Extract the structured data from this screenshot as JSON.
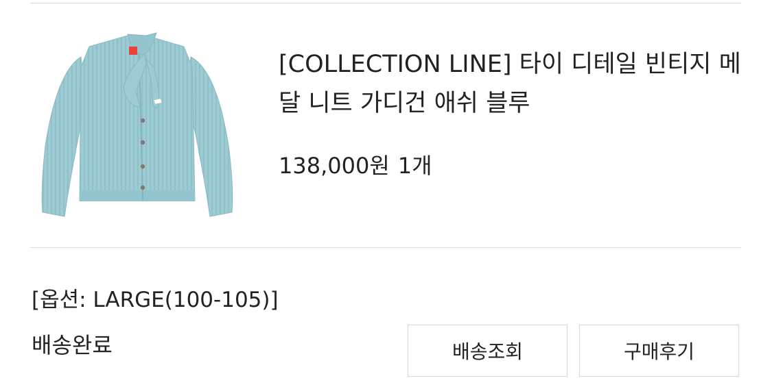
{
  "order_item": {
    "product": {
      "name": "[COLLECTION LINE] 타이 디테일 빈티지 메달 니트 가디건 애쉬 블루",
      "price": "138,000원",
      "quantity": "1개",
      "image": "ash blue knit cardigan with tie"
    },
    "option": "[옵션: LARGE(100-105)]",
    "status": "배송완료",
    "buttons": {
      "track_shipping": "배송조회",
      "write_review": "구매후기"
    },
    "colors": {
      "cardigan": "#9ccbd3",
      "divider": "#dcdcdc",
      "text": "#222222"
    }
  }
}
